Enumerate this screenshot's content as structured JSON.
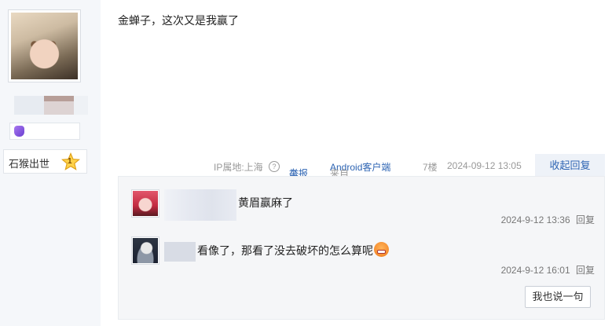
{
  "author": {
    "level_title": "石猴出世",
    "level_number": "1"
  },
  "post": {
    "content": "金蝉子，这次又是我赢了",
    "ip_location": "IP属地:上海",
    "help_glyph": "?",
    "report_icon": "⚠",
    "report_label": "举报",
    "source_prefix": "来自",
    "source_client": "Android客户端",
    "floor": "7楼",
    "time": "2024-09-12 13:05",
    "fold_label": "收起回复"
  },
  "replies": [
    {
      "text": "黄眉赢麻了",
      "time": "2024-9-12 13:36",
      "reply_label": "回复"
    },
    {
      "text": "看像了，那看了没去破坏的怎么算呢",
      "time": "2024-9-12 16:01",
      "reply_label": "回复"
    }
  ],
  "reply_box": {
    "say_label": "我也说一句"
  },
  "colors": {
    "link": "#2d64b3",
    "meta": "#999999",
    "reply_bg": "#f5f6f8"
  },
  "icons": [
    "help-icon",
    "warning-icon",
    "grin-emoji-icon",
    "star-level-icon",
    "member-badge-icon"
  ]
}
